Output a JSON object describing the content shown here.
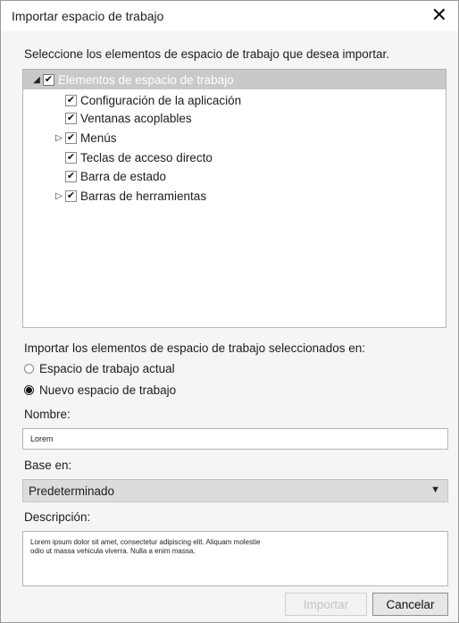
{
  "dialog": {
    "title": "Importar espacio de trabajo",
    "close_glyph": "✕"
  },
  "prompt": "Seleccione los elementos de espacio de trabajo que desea importar.",
  "tree": {
    "root": {
      "label": "Elementos de espacio de trabajo",
      "expanded": true,
      "checked": true
    },
    "items": [
      {
        "label": "Configuración de la aplicación",
        "checked": true,
        "expandable": false
      },
      {
        "label": "Ventanas acoplables",
        "checked": true,
        "expandable": false
      },
      {
        "label": "Menús",
        "checked": true,
        "expandable": true
      },
      {
        "label": "Teclas de acceso directo",
        "checked": true,
        "expandable": false
      },
      {
        "label": "Barra de estado",
        "checked": true,
        "expandable": false
      },
      {
        "label": "Barras de herramientas",
        "checked": true,
        "expandable": true
      }
    ],
    "check_glyph": "✔",
    "expanded_glyph": "◢",
    "collapsed_glyph": "▷"
  },
  "import_target": {
    "label": "Importar los elementos de espacio de trabajo seleccionados en:",
    "options": [
      {
        "label": "Espacio de trabajo actual",
        "selected": false
      },
      {
        "label": "Nuevo espacio de trabajo",
        "selected": true
      }
    ]
  },
  "name": {
    "label": "Nombre:",
    "value": "Lorem"
  },
  "base": {
    "label": "Base en:",
    "value": "Predeterminado",
    "arrow_glyph": "▼"
  },
  "description": {
    "label": "Descripción:",
    "value": "Lorem ipsum dolor sit amet, consectetur adipiscing elit. Aliquam molestie\nodio ut massa vehicula viverra. Nulla a enim massa."
  },
  "buttons": {
    "import": "Importar",
    "cancel": "Cancelar"
  },
  "colors": {
    "dialog_bg": "#f5f5f5",
    "tree_root_highlight": "#c9c9c9",
    "disabled_text": "#c4c4c4"
  }
}
